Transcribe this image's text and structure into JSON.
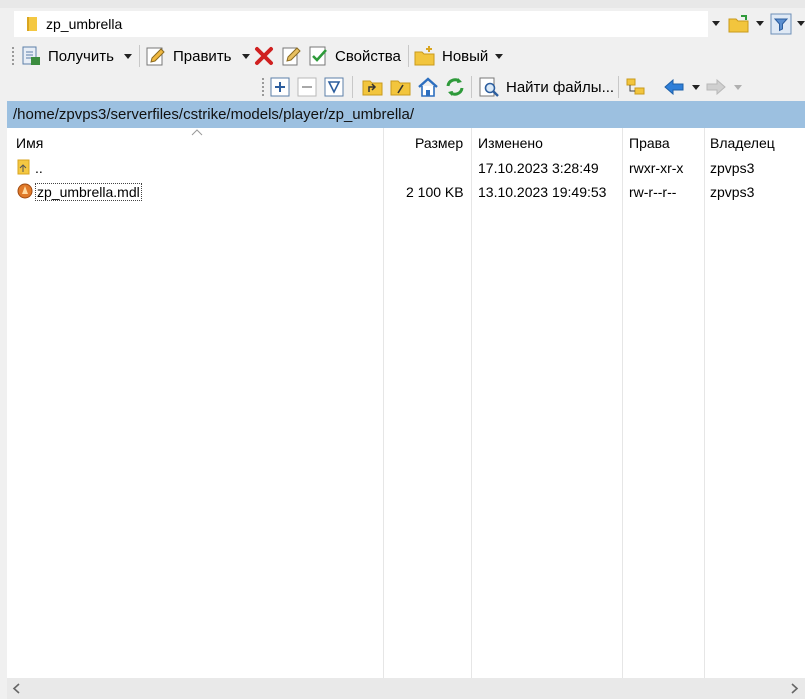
{
  "path_combo": {
    "value": "zp_umbrella"
  },
  "toolbar1": {
    "download": "Получить",
    "edit": "Править",
    "properties": "Свойства",
    "new": "Новый"
  },
  "toolbar2": {
    "find_files": "Найти файлы..."
  },
  "current_path": "/home/zpvps3/serverfiles/cstrike/models/player/zp_umbrella/",
  "columns": {
    "name": "Имя",
    "size": "Размер",
    "modified": "Изменено",
    "rights": "Права",
    "owner": "Владелец"
  },
  "files": [
    {
      "name": "..",
      "size": "",
      "modified": "17.10.2023 3:28:49",
      "rights": "rwxr-xr-x",
      "owner": "zpvps3",
      "icon": "parent-folder-icon"
    },
    {
      "name": "zp_umbrella.mdl",
      "size": "2 100 KB",
      "modified": "13.10.2023 19:49:53",
      "rights": "rw-r--r--",
      "owner": "zpvps3",
      "icon": "mdl-file-icon"
    }
  ],
  "colors": {
    "path_bar": "#9cc0e0",
    "accent_red": "#d02020",
    "accent_blue": "#2f7fd8"
  }
}
